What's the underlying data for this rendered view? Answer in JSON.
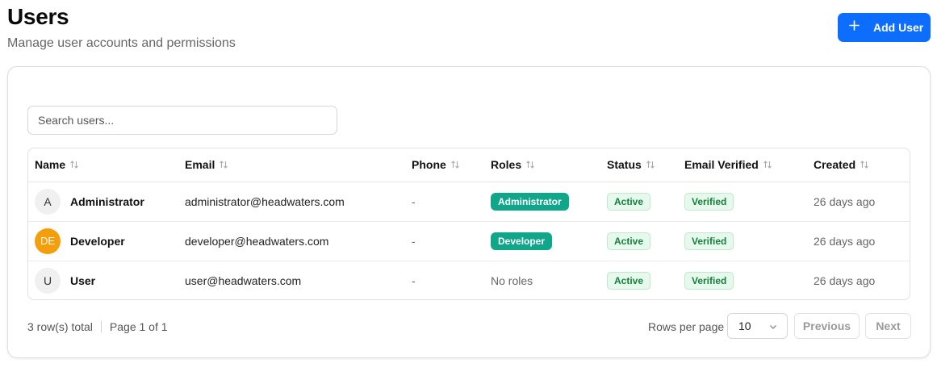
{
  "header": {
    "title": "Users",
    "subtitle": "Manage user accounts and permissions",
    "add_button_label": "Add User"
  },
  "search": {
    "placeholder": "Search users..."
  },
  "table": {
    "columns": {
      "name": "Name",
      "email": "Email",
      "phone": "Phone",
      "roles": "Roles",
      "status": "Status",
      "email_verified": "Email Verified",
      "created": "Created"
    },
    "rows": [
      {
        "avatar": "A",
        "name": "Administrator",
        "email": "administrator@headwaters.com",
        "phone": "-",
        "role": "Administrator",
        "status": "Active",
        "verified": "Verified",
        "created": "26 days ago"
      },
      {
        "avatar": "DE",
        "name": "Developer",
        "email": "developer@headwaters.com",
        "phone": "-",
        "role": "Developer",
        "status": "Active",
        "verified": "Verified",
        "created": "26 days ago"
      },
      {
        "avatar": "U",
        "name": "User",
        "email": "user@headwaters.com",
        "phone": "-",
        "role": "No roles",
        "status": "Active",
        "verified": "Verified",
        "created": "26 days ago"
      }
    ]
  },
  "footer": {
    "total": "3 row(s) total",
    "page": "Page 1 of 1",
    "rows_per_page_label": "Rows per page",
    "rows_per_page_value": "10",
    "previous_label": "Previous",
    "next_label": "Next"
  },
  "colors": {
    "primary": "#0d6efd",
    "role_badge": "#0fa68a",
    "status_bg": "#e6f9ec",
    "status_text": "#15803d",
    "avatar_orange": "#f59e0b"
  },
  "icons": [
    "plus-icon",
    "sort-icon",
    "chevron-down-icon"
  ]
}
